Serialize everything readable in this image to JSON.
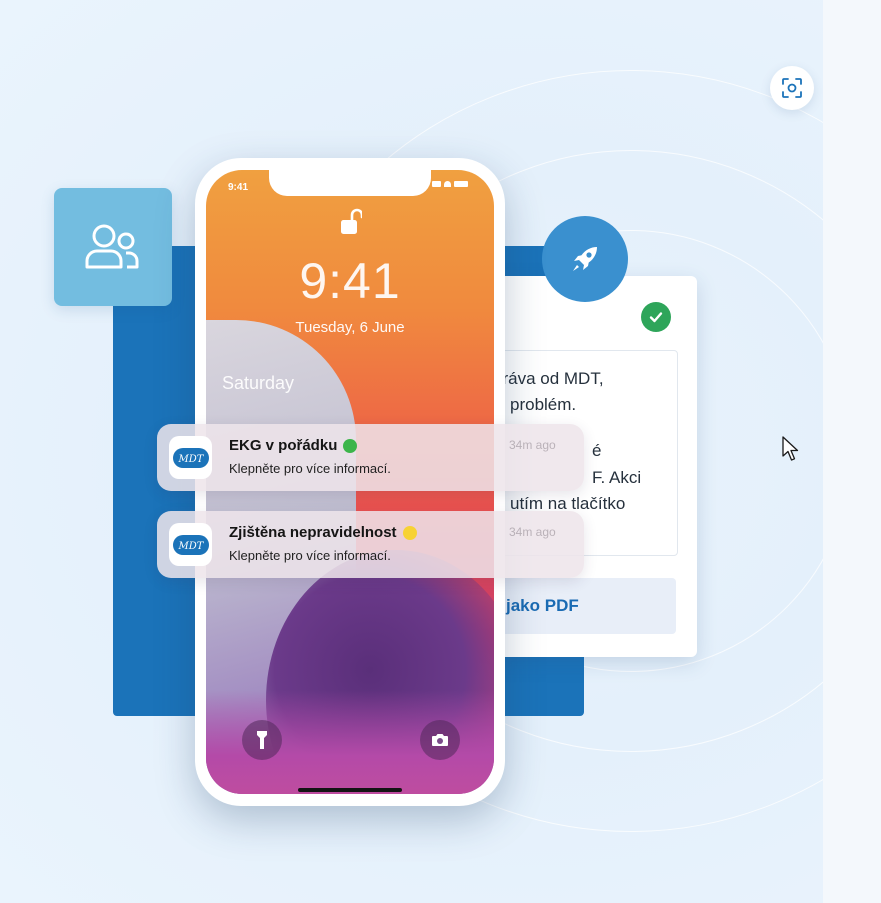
{
  "phone": {
    "status_time": "9:41",
    "clock": "9:41",
    "date": "Tuesday, 6 June",
    "day_label": "Saturday"
  },
  "notifications": [
    {
      "app_logo_text": "MDT",
      "title": "EKG v pořádku",
      "status_color": "#3cb54a",
      "body": "Klepněte pro více informací.",
      "time": "34m ago"
    },
    {
      "app_logo_text": "MDT",
      "title": "Zjištěna nepravidelnost",
      "status_color": "#f7d233",
      "body": "Klepněte pro více informací.",
      "time": "34m ago"
    }
  ],
  "card": {
    "message_lines": [
      "práva od MDT,",
      "problém.",
      "é",
      "F. Akci",
      "utím na tlačítko"
    ],
    "pdf_button_label": "jako PDF"
  },
  "icons": {
    "scan": "scan-icon",
    "users": "users-icon",
    "rocket": "rocket-icon",
    "check": "check-icon",
    "lock": "unlocked-padlock-icon",
    "flashlight": "flashlight-icon",
    "camera": "camera-icon",
    "cursor": "mouse-pointer-icon"
  },
  "colors": {
    "brand_blue": "#1b73b9",
    "rocket_blue": "#3a90cf",
    "users_tile": "#73bde0",
    "success_green": "#2ea55a",
    "link_blue": "#1a6bb3"
  }
}
